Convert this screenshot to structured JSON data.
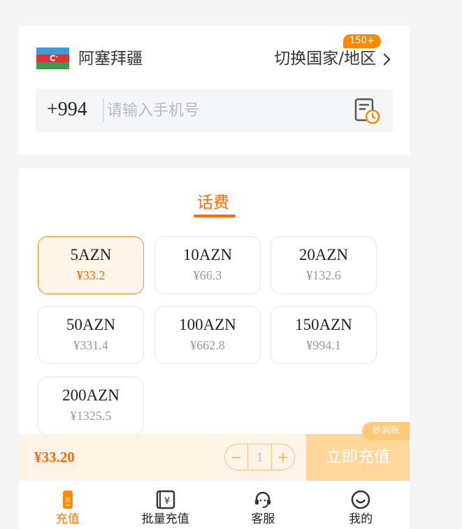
{
  "country": {
    "name": "阿塞拜疆",
    "switch_label": "切换国家/地区",
    "badge": "150+"
  },
  "phone": {
    "prefix": "+994",
    "placeholder": "请输入手机号",
    "value": ""
  },
  "tabs": [
    {
      "label": "话费",
      "active": true
    }
  ],
  "options": [
    {
      "amount": "5AZN",
      "price": "¥33.2",
      "selected": true
    },
    {
      "amount": "10AZN",
      "price": "¥66.3",
      "selected": false
    },
    {
      "amount": "20AZN",
      "price": "¥132.6",
      "selected": false
    },
    {
      "amount": "50AZN",
      "price": "¥331.4",
      "selected": false
    },
    {
      "amount": "100AZN",
      "price": "¥662.8",
      "selected": false
    },
    {
      "amount": "150AZN",
      "price": "¥994.1",
      "selected": false
    },
    {
      "amount": "200AZN",
      "price": "¥1325.5",
      "selected": false
    }
  ],
  "checkout": {
    "total": "¥33.20",
    "minus": "−",
    "quantity": "1",
    "plus": "+",
    "charge_label": "立即充值",
    "fast_badge": "秒到账"
  },
  "nav": {
    "items": [
      {
        "label": "充值",
        "icon": "recharge-icon",
        "active": true,
        "icon_text": "充"
      },
      {
        "label": "批量充值",
        "icon": "batch-recharge-icon",
        "active": false,
        "icon_text": "¥"
      },
      {
        "label": "客服",
        "icon": "headset-icon",
        "active": false
      },
      {
        "label": "我的",
        "icon": "smiley-icon",
        "active": false
      }
    ]
  },
  "colors": {
    "accent": "#ff6a00",
    "selected_bg": "#fff5e8",
    "charge_btn": "#ffd79b"
  }
}
